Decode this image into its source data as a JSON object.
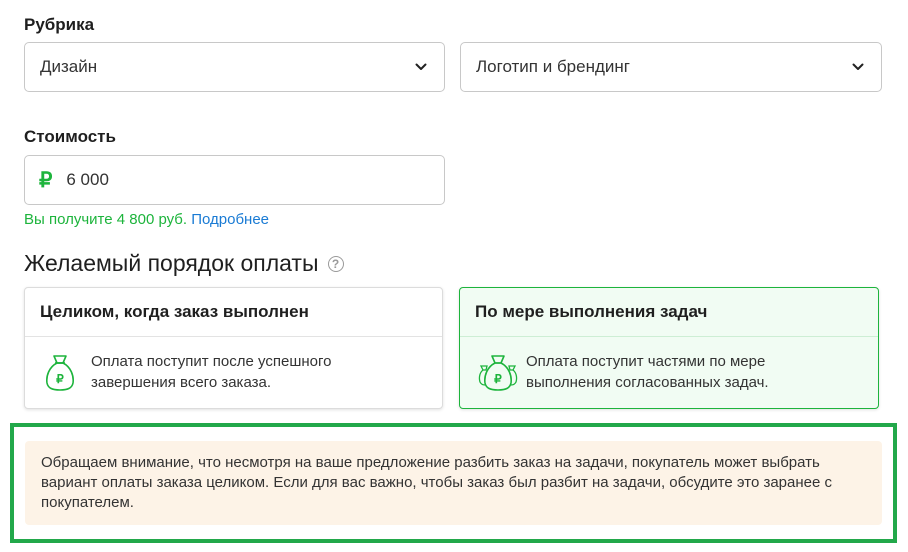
{
  "rubric": {
    "label": "Рубрика",
    "category_value": "Дизайн",
    "subcategory_value": "Логотип и брендинг"
  },
  "price": {
    "label": "Стоимость",
    "currency_symbol": "₽",
    "value": "6 000",
    "hint_text": "Вы получите 4 800 руб.",
    "hint_link": "Подробнее"
  },
  "payment_order": {
    "title": "Желаемый порядок оплаты",
    "help_symbol": "?",
    "options": [
      {
        "title": "Целиком, когда заказ выполнен",
        "description": "Оплата поступит после успешного завершения всего заказа.",
        "icon": "money-bag-icon",
        "selected": false
      },
      {
        "title": "По мере выполнения задач",
        "description": "Оплата поступит частями по мере выполнения согласованных задач.",
        "icon": "money-bags-icon",
        "selected": true
      }
    ],
    "notice": "Обращаем внимание, что несмотря на ваше предложение разбить заказ на задачи, покупатель может выбрать вариант оплаты заказа целиком. Если для вас важно, чтобы заказ был разбит на задачи, обсудите это заранее с покупателем."
  },
  "colors": {
    "accent_green": "#1db43c",
    "link_blue": "#1a7bd4",
    "notice_bg": "#fdf3e7",
    "highlight_border": "#22a84a"
  }
}
